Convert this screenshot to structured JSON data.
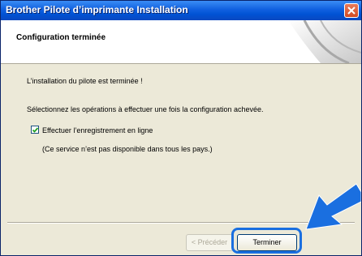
{
  "window": {
    "title": "Brother Pilote d’imprimante Installation"
  },
  "header": {
    "title": "Configuration terminée"
  },
  "content": {
    "line1": "L’installation du pilote est terminée !",
    "line2": "Sélectionnez les opérations à effectuer une fois la configuration achevée.",
    "checkbox_label": "Effectuer l’enregistrement en ligne",
    "checkbox_checked": true,
    "note": "(Ce service n’est pas disponible dans tous les pays.)"
  },
  "buttons": {
    "prev": "< Précéder",
    "finish": "Terminer"
  },
  "colors": {
    "arrow": "#1a6fe0",
    "titlebar": "#0052d4"
  }
}
